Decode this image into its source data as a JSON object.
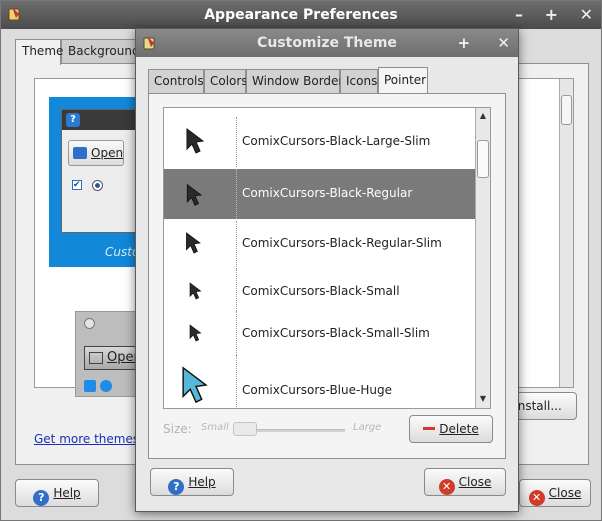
{
  "window": {
    "title": "Appearance Preferences",
    "controls": [
      "–",
      "+",
      "✕"
    ],
    "tabs": [
      {
        "label": "Theme"
      },
      {
        "label": "Background"
      }
    ],
    "preview_theme_label": "Custo",
    "preview_open_label": "Open",
    "get_more_link": "Get more themes o",
    "install_button": "Install...",
    "help_button": "Help",
    "close_button": "Close"
  },
  "dialog": {
    "title": "Customize Theme",
    "controls": [
      "+",
      "✕"
    ],
    "tabs": [
      {
        "label": "Controls"
      },
      {
        "label": "Colors"
      },
      {
        "label": "Window Border"
      },
      {
        "label": "Icons"
      },
      {
        "label": "Pointer"
      }
    ],
    "active_tab": "Pointer",
    "cursors": [
      {
        "name": "ComixCursors-Black-Large-Slim",
        "selected": false,
        "color": "#2a2a2a"
      },
      {
        "name": "ComixCursors-Black-Regular",
        "selected": true,
        "color": "#2a2a2a"
      },
      {
        "name": "ComixCursors-Black-Regular-Slim",
        "selected": false,
        "color": "#2a2a2a"
      },
      {
        "name": "ComixCursors-Black-Small",
        "selected": false,
        "color": "#2a2a2a"
      },
      {
        "name": "ComixCursors-Black-Small-Slim",
        "selected": false,
        "color": "#2a2a2a"
      },
      {
        "name": "ComixCursors-Blue-Huge",
        "selected": false,
        "color": "#56b8d8"
      }
    ],
    "size": {
      "label": "Size:",
      "small_label": "Small",
      "large_label": "Large"
    },
    "delete_button": "Delete",
    "help_button": "Help",
    "close_button": "Close"
  }
}
